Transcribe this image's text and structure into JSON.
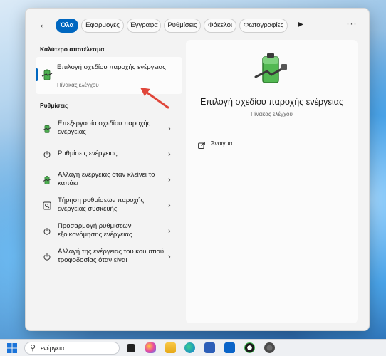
{
  "tabs": [
    {
      "label": "Όλα",
      "active": true
    },
    {
      "label": "Εφαρμογές",
      "active": false
    },
    {
      "label": "Έγγραφα",
      "active": false
    },
    {
      "label": "Ρυθμίσεις",
      "active": false
    },
    {
      "label": "Φάκελοι",
      "active": false
    },
    {
      "label": "Φωτογραφίες",
      "active": false
    }
  ],
  "tab_more_icon": "play-icon",
  "more_menu_icon": "ellipsis-icon",
  "best_match": {
    "heading": "Καλύτερο αποτέλεσμα",
    "title": "Επιλογή σχεδίου παροχής ενέργειας",
    "subtitle": "Πίνακας ελέγχου",
    "icon": "battery-plug-icon"
  },
  "settings": {
    "heading": "Ρυθμίσεις",
    "items": [
      {
        "label": "Επεξεργασία σχεδίου παροχής ενέργειας",
        "icon": "battery-plug-icon"
      },
      {
        "label": "Ρυθμίσεις ενέργειας",
        "icon": "power-icon"
      },
      {
        "label": "Αλλαγή ενέργειας όταν κλείνει το καπάκι",
        "icon": "battery-plug-icon"
      },
      {
        "label": "Τήρηση ρυθμίσεων παροχής ενέργειας συσκευής",
        "icon": "search-settings-icon"
      },
      {
        "label": "Προσαρμογή ρυθμίσεων εξοικονόμησης ενέργειας",
        "icon": "power-icon"
      },
      {
        "label": "Αλλαγή της ενέργειας του κουμπιού τροφοδοσίας όταν είναι",
        "icon": "power-icon"
      }
    ]
  },
  "detail": {
    "title": "Επιλογή σχεδίου παροχής ενέργειας",
    "subtitle": "Πίνακας ελέγχου",
    "action_label": "Άνοιγμα",
    "action_icon": "open-external-icon"
  },
  "taskbar": {
    "search_value": "ενέργεια",
    "icons": [
      "windows-start-icon",
      "search-icon",
      "task-view-icon",
      "copilot-icon",
      "file-explorer-icon",
      "edge-icon",
      "store-icon",
      "outlook-icon",
      "xbox-icon",
      "settings-gear-icon"
    ]
  },
  "colors": {
    "accent": "#0067c0",
    "arrow": "#e0463a"
  }
}
